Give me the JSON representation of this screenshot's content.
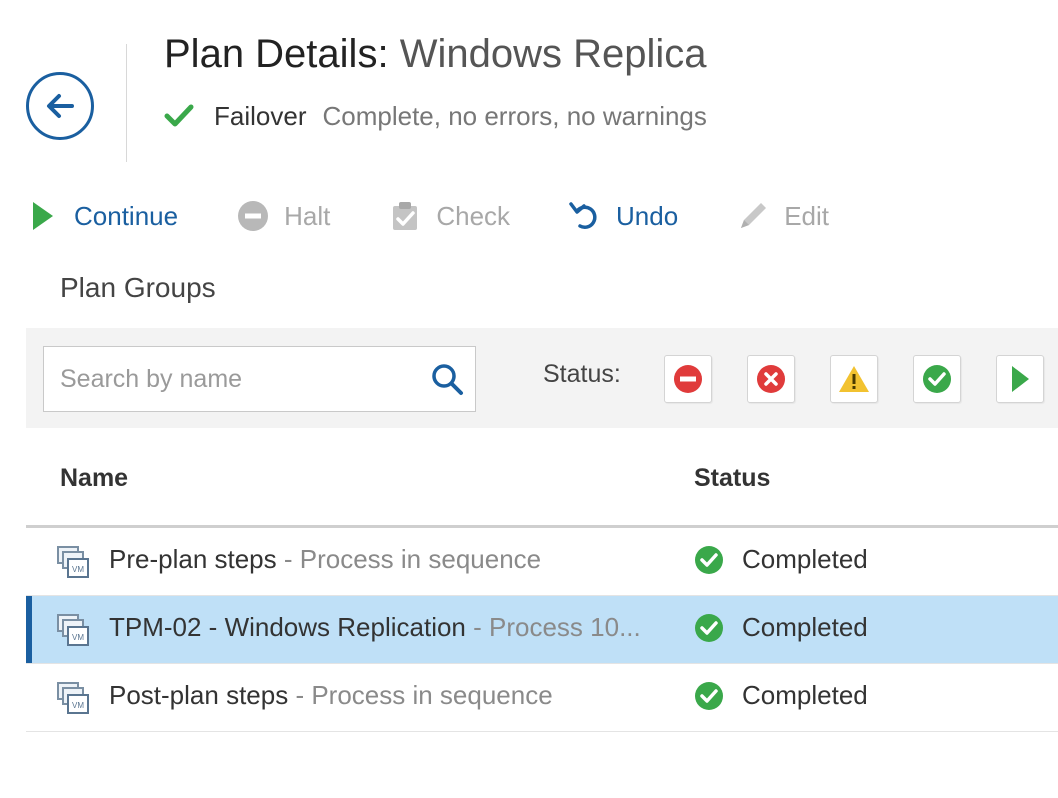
{
  "header": {
    "title_prefix": "Plan Details:",
    "title_name": "Windows Replica",
    "operation": "Failover",
    "operation_status": "Complete, no errors, no warnings"
  },
  "toolbar": {
    "continue_label": "Continue",
    "halt_label": "Halt",
    "check_label": "Check",
    "undo_label": "Undo",
    "edit_label": "Edit"
  },
  "plan_groups": {
    "title": "Plan Groups",
    "search_placeholder": "Search by name",
    "status_label": "Status:",
    "status_filters": [
      "halted",
      "error",
      "warning",
      "completed",
      "running"
    ]
  },
  "table": {
    "columns": {
      "name": "Name",
      "status": "Status"
    },
    "separator": " - ",
    "rows": [
      {
        "name": "Pre-plan steps",
        "description": "Process in sequence",
        "status": "Completed"
      },
      {
        "name": "TPM-02 - Windows Replication",
        "description": "Process 10...",
        "status": "Completed"
      },
      {
        "name": "Post-plan steps",
        "description": "Process in sequence",
        "status": "Completed"
      }
    ]
  },
  "colors": {
    "accent": "#1a5fa0",
    "success": "#3aa84a",
    "error": "#e03b3b",
    "warning": "#f2c230",
    "disabled": "#a8a8a8",
    "selected_row": "#bfe0f7"
  }
}
